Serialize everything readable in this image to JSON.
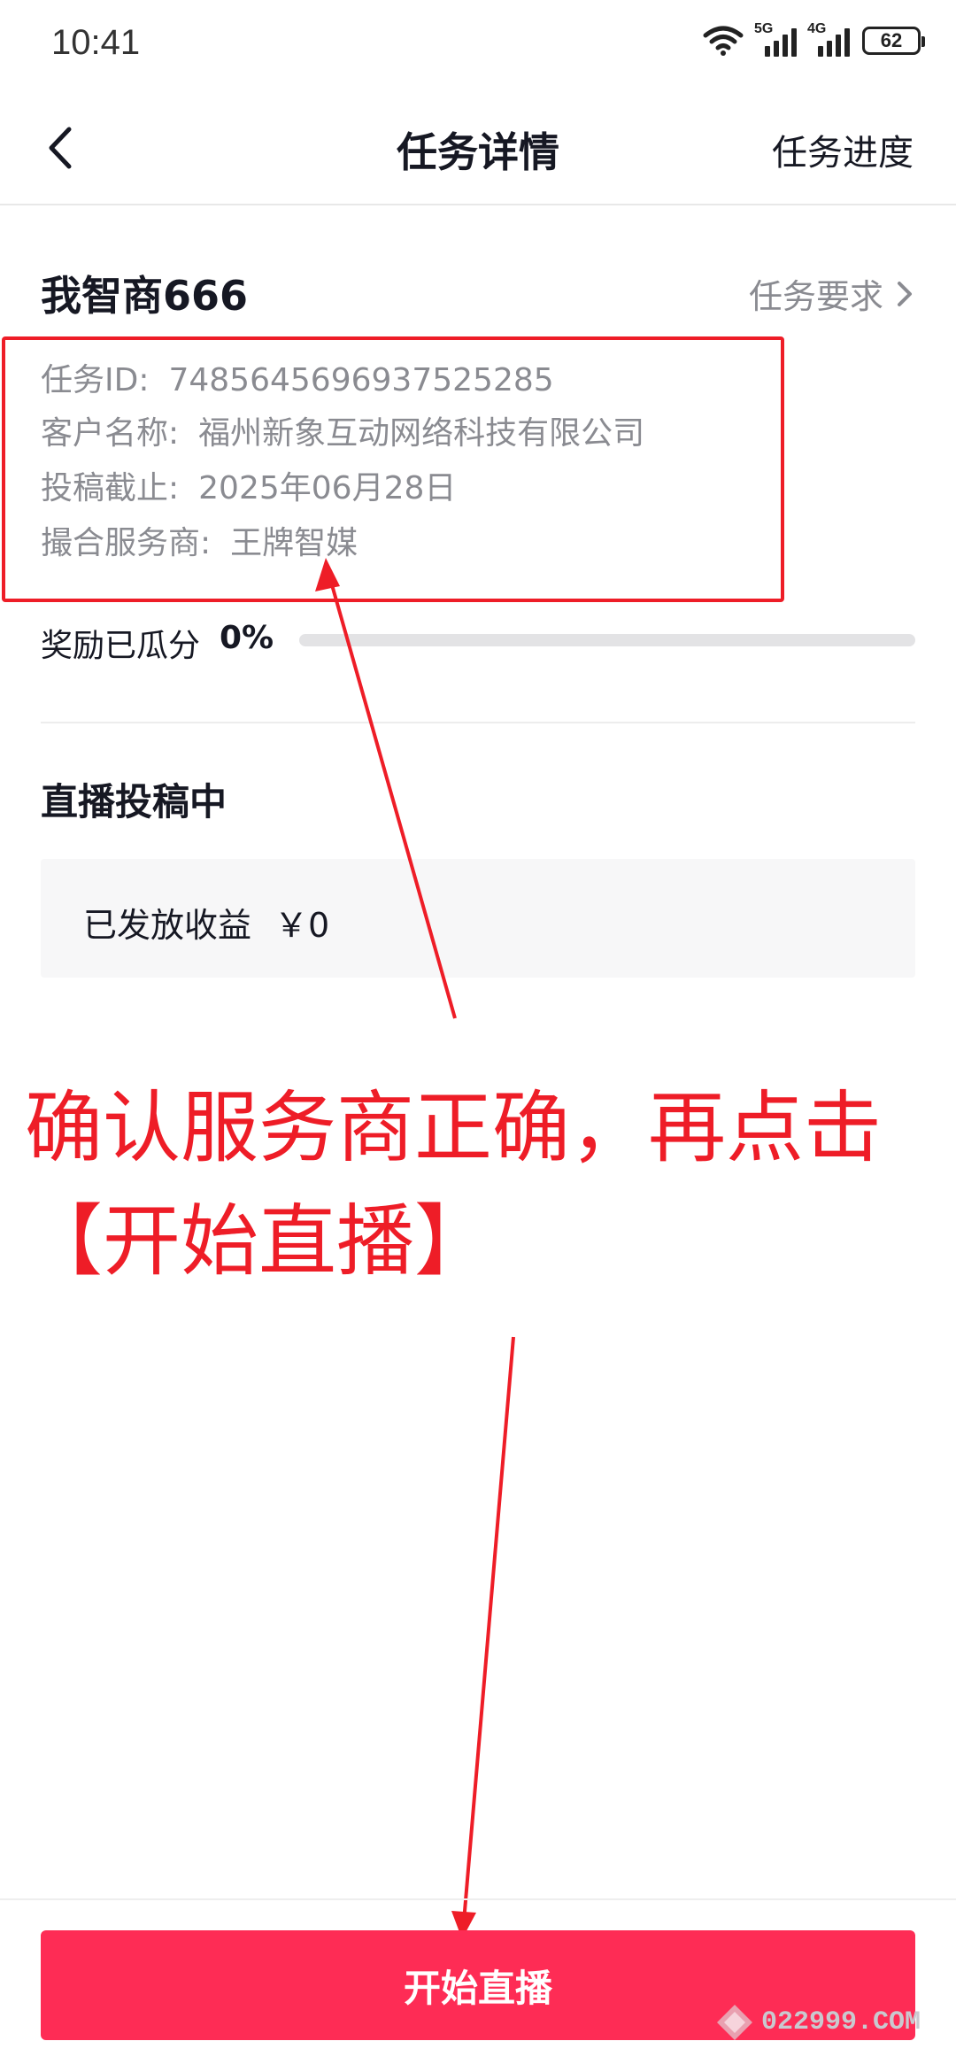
{
  "status_bar": {
    "time": "10:41",
    "network_1": "5G",
    "network_2": "4G",
    "battery": "62",
    "icons": [
      "wifi-icon",
      "signal-5g-icon",
      "signal-4g-icon",
      "battery-icon"
    ]
  },
  "header": {
    "title": "任务详情",
    "right_link": "任务进度",
    "back_icon": "chevron-left-icon"
  },
  "task": {
    "name": "我智商666",
    "requirements_link": "任务要求",
    "info": [
      {
        "label": "任务ID:",
        "value": "7485645696937525285"
      },
      {
        "label": "客户名称:",
        "value": "福州新象互动网络科技有限公司"
      },
      {
        "label": "投稿截止:",
        "value": "2025年06月28日"
      },
      {
        "label": "撮合服务商:",
        "value": "王牌智媒"
      }
    ],
    "reward_label": "奖励已瓜分",
    "reward_percent_text": "0%",
    "reward_progress": 0
  },
  "section": {
    "title": "直播投稿中",
    "income_label": "已发放收益",
    "income_value": "￥0"
  },
  "annotation": {
    "text": "确认服务商正确，再点击【开始直播】",
    "color": "#ee1d27"
  },
  "bottom": {
    "button_label": "开始直播",
    "button_color": "#fe2c55"
  },
  "watermark": {
    "text": "022999.COM"
  }
}
